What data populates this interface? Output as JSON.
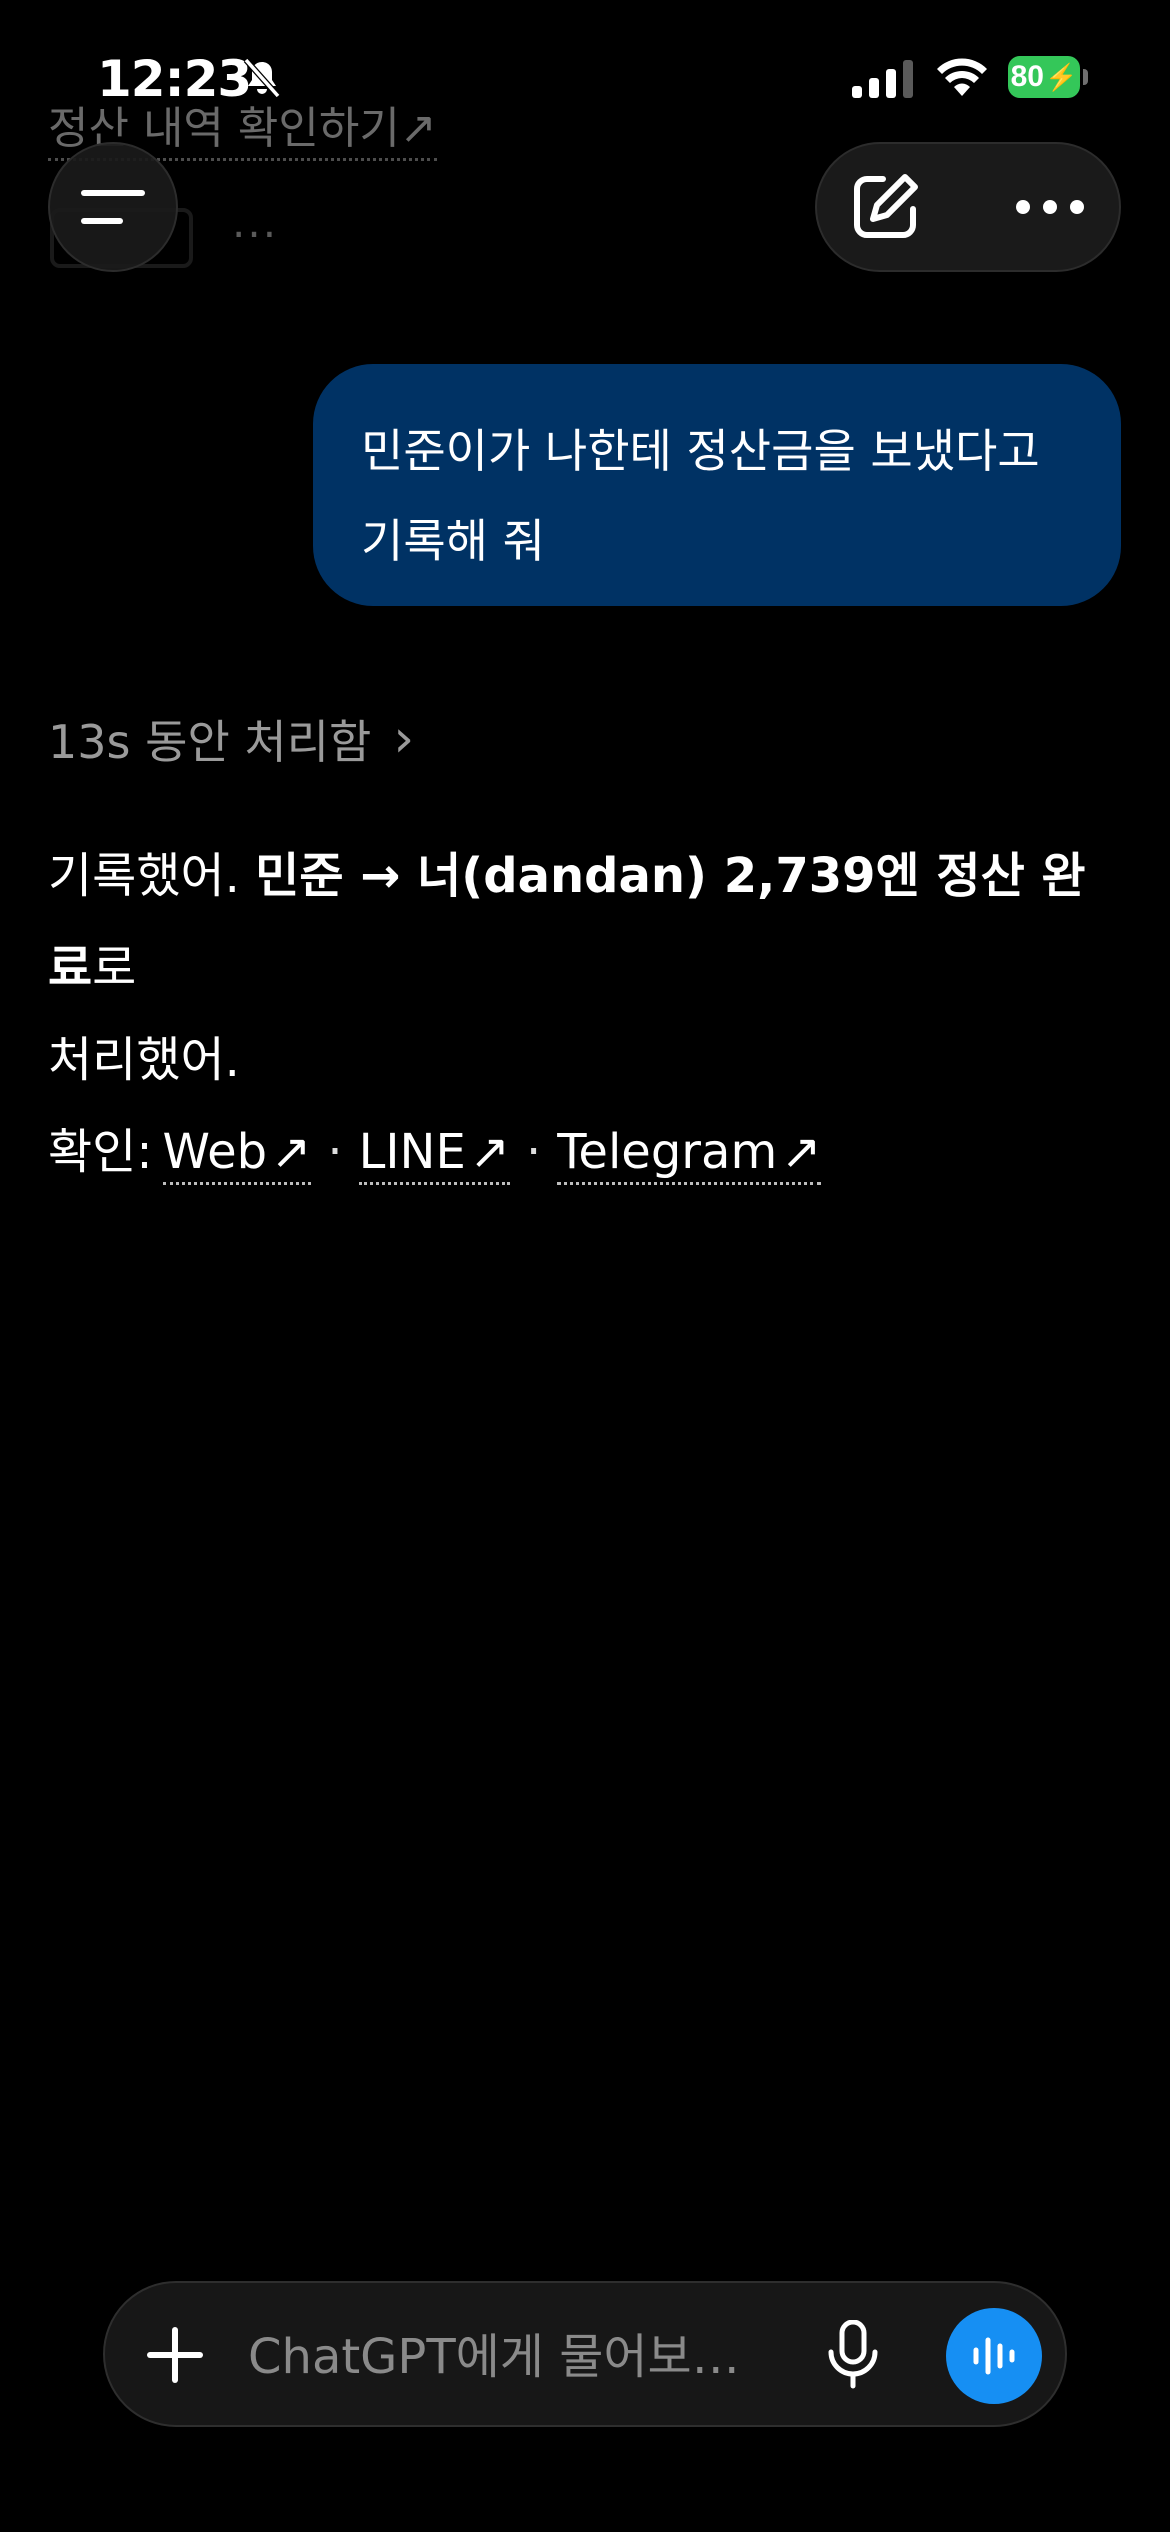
{
  "status_bar": {
    "time": "12:23",
    "battery": "80"
  },
  "faded_content": {
    "link_text": "정산 내역 확인하기↗",
    "more": "···"
  },
  "header": {
    "menu_icon": "hamburger-icon",
    "edit_icon": "compose-icon",
    "more_icon": "more-horizontal-icon"
  },
  "messages": {
    "user": {
      "line1": "민준이가 나한테 정산금을 보냈다고",
      "line2": "기록해 줘"
    },
    "thinking": {
      "label": "13s 동안 처리함",
      "chevron": "›"
    },
    "assistant": {
      "part1": "기록했어. ",
      "bold1": "민준 → 너(dandan) 2,739엔 정산 완료",
      "part2": "로",
      "line2": "처리했어.",
      "confirm_label": "확인: ",
      "links": [
        {
          "label": "Web",
          "arrow": "↗"
        },
        {
          "label": "LINE",
          "arrow": "↗"
        },
        {
          "label": "Telegram",
          "arrow": "↗"
        }
      ],
      "separator": "·"
    }
  },
  "composer": {
    "placeholder": "ChatGPT에게 물어보…",
    "plus_icon": "plus-icon",
    "mic_icon": "microphone-icon",
    "voice_icon": "voice-mode-icon",
    "accent": "#168ff3"
  },
  "colors": {
    "user_bubble": "#003264",
    "background": "#000000",
    "battery": "#34c759"
  }
}
